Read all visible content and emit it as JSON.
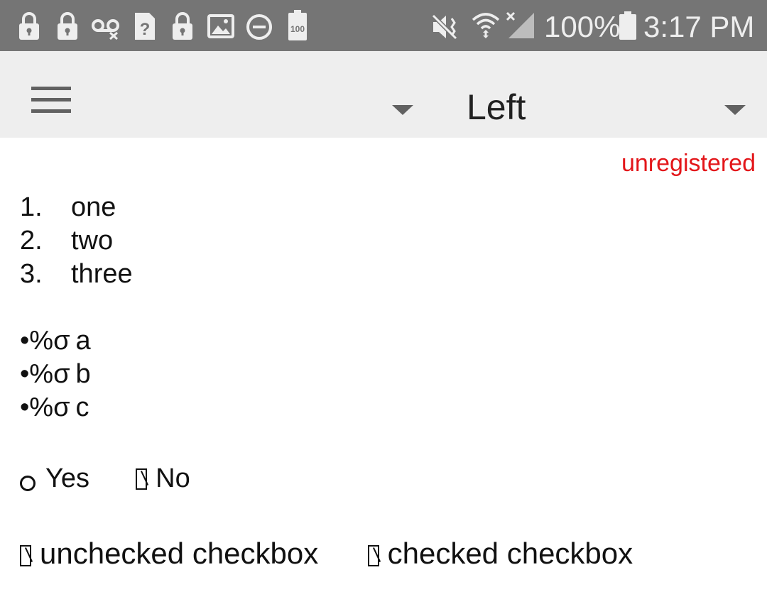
{
  "status_bar": {
    "icons": [
      "lock-icon",
      "lock-icon",
      "voicemail-icon",
      "unknown-file-icon",
      "lock-icon",
      "image-icon",
      "do-not-disturb-icon",
      "battery-100-icon",
      "vibrate-icon",
      "wifi-icon",
      "no-signal-icon",
      "battery-full-icon"
    ],
    "battery_badge": "100",
    "battery_percent": "100%",
    "time": "3:17 PM"
  },
  "toolbar": {
    "menu_icon": "hamburger-menu-icon",
    "title": "Left",
    "dropdown_icon": "caret-down-icon"
  },
  "content": {
    "status_label": "unregistered",
    "numbered_list": [
      {
        "number": "1.",
        "text": "one"
      },
      {
        "number": "2.",
        "text": "two"
      },
      {
        "number": "3.",
        "text": "three"
      }
    ],
    "bullet_list": [
      {
        "marker": "•%σ",
        "text": "a"
      },
      {
        "marker": "•%σ",
        "text": "b"
      },
      {
        "marker": "•%σ",
        "text": "c"
      }
    ],
    "radio": {
      "yes_label": "Yes",
      "no_label": "No"
    },
    "checkboxes": {
      "unchecked_label": "unchecked checkbox",
      "checked_label": "checked checkbox"
    }
  },
  "colors": {
    "status_bar_bg": "#757575",
    "toolbar_bg": "#eeeeee",
    "unregistered_text": "#e3161a"
  }
}
